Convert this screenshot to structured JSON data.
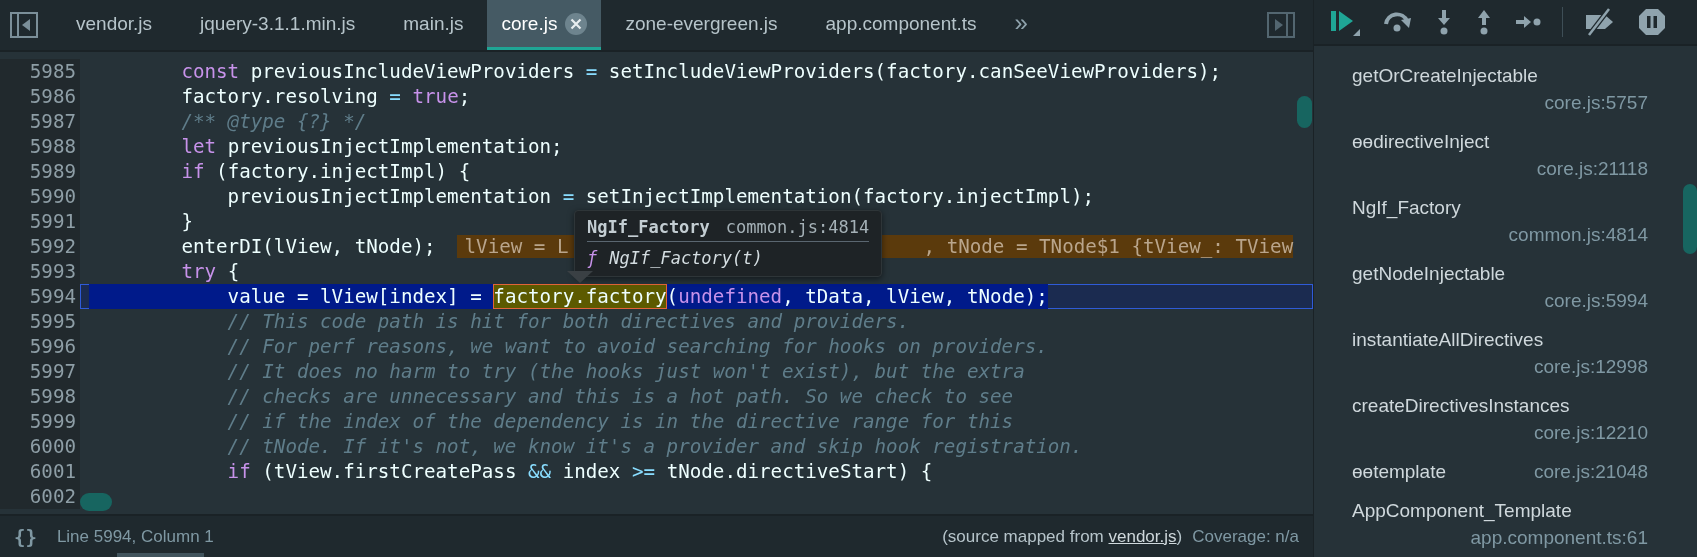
{
  "tabs": [
    {
      "label": "vendor.js",
      "selected": false
    },
    {
      "label": "jquery-3.1.1.min.js",
      "selected": false
    },
    {
      "label": "main.js",
      "selected": false
    },
    {
      "label": "core.js",
      "selected": true
    },
    {
      "label": "zone-evergreen.js",
      "selected": false
    },
    {
      "label": "app.component.ts",
      "selected": false
    }
  ],
  "overflow_label": "»",
  "editor": {
    "lines": [
      {
        "number": "5985",
        "current": false,
        "tokens": [
          {
            "text": "        const",
            "kind": "keyword"
          },
          {
            "text": " previousIncludeViewProviders ",
            "kind": "plain"
          },
          {
            "text": "=",
            "kind": "operator"
          },
          {
            "text": " setIncludeViewProviders(factory.canSeeViewProviders);",
            "kind": "plain"
          }
        ]
      },
      {
        "number": "5986",
        "current": false,
        "tokens": [
          {
            "text": "        factory.resolving ",
            "kind": "plain"
          },
          {
            "text": "=",
            "kind": "operator"
          },
          {
            "text": " true",
            "kind": "keyword"
          },
          {
            "text": ";",
            "kind": "plain"
          }
        ]
      },
      {
        "number": "5987",
        "current": false,
        "tokens": [
          {
            "text": "        /** @type {?} */",
            "kind": "comment"
          }
        ]
      },
      {
        "number": "5988",
        "current": false,
        "tokens": [
          {
            "text": "        let",
            "kind": "keyword"
          },
          {
            "text": " previousInjectImplementation;",
            "kind": "plain"
          }
        ]
      },
      {
        "number": "5989",
        "current": false,
        "tokens": [
          {
            "text": "        if",
            "kind": "keyword"
          },
          {
            "text": " (factory.injectImpl) {",
            "kind": "plain"
          }
        ]
      },
      {
        "number": "5990",
        "current": false,
        "tokens": [
          {
            "text": "            previousInjectImplementation ",
            "kind": "plain"
          },
          {
            "text": "=",
            "kind": "operator"
          },
          {
            "text": " setInjectImplementation(factory.injectImpl);",
            "kind": "plain"
          }
        ]
      },
      {
        "number": "5991",
        "current": false,
        "tokens": [
          {
            "text": "        }",
            "kind": "plain"
          }
        ]
      },
      {
        "number": "5992",
        "current": false,
        "tokens": [
          {
            "text": "        enterDI(lView, tNode);",
            "kind": "plain"
          }
        ],
        "inline_value": [
          "lView = L",
          ", tNode = TNode$1 {tView_: TView"
        ]
      },
      {
        "number": "5993",
        "current": false,
        "tokens": [
          {
            "text": "        try",
            "kind": "keyword"
          },
          {
            "text": " {",
            "kind": "plain"
          }
        ]
      },
      {
        "number": "5994",
        "current": true,
        "tokens": [
          {
            "text": "            value = lView[index] = ",
            "kind": "plain"
          },
          {
            "text": "factory.factory",
            "kind": "match"
          },
          {
            "text": "(",
            "kind": "plain"
          },
          {
            "text": "undefined",
            "kind": "keyword"
          },
          {
            "text": ", tData, lView, tNode);",
            "kind": "plain"
          }
        ]
      },
      {
        "number": "5995",
        "current": false,
        "tokens": [
          {
            "text": "            // This code path is hit for both directives and providers.",
            "kind": "comment"
          }
        ]
      },
      {
        "number": "5996",
        "current": false,
        "tokens": [
          {
            "text": "            // For perf reasons, we want to avoid searching for hooks on providers.",
            "kind": "comment"
          }
        ]
      },
      {
        "number": "5997",
        "current": false,
        "tokens": [
          {
            "text": "            // It does no harm to try (the hooks just won't exist), but the extra",
            "kind": "comment"
          }
        ]
      },
      {
        "number": "5998",
        "current": false,
        "tokens": [
          {
            "text": "            // checks are unnecessary and this is a hot path. So we check to see",
            "kind": "comment"
          }
        ]
      },
      {
        "number": "5999",
        "current": false,
        "tokens": [
          {
            "text": "            // if the index of the dependency is in the directive range for this",
            "kind": "comment"
          }
        ]
      },
      {
        "number": "6000",
        "current": false,
        "tokens": [
          {
            "text": "            // tNode. If it's not, we know it's a provider and skip hook registration.",
            "kind": "comment"
          }
        ]
      },
      {
        "number": "6001",
        "current": false,
        "tokens": [
          {
            "text": "            if",
            "kind": "keyword"
          },
          {
            "text": " (tView.firstCreatePass ",
            "kind": "plain"
          },
          {
            "text": "&&",
            "kind": "operator"
          },
          {
            "text": " index ",
            "kind": "plain"
          },
          {
            "text": ">=",
            "kind": "operator"
          },
          {
            "text": " tNode.directiveStart) {",
            "kind": "plain"
          }
        ]
      },
      {
        "number": "6002",
        "current": false
      }
    ],
    "tooltip": {
      "title": "NgIf_Factory",
      "location": "common.js:4814",
      "symbol": "ƒ",
      "signature": "NgIf_Factory(t)"
    }
  },
  "status_bar": {
    "icon_label": "{}",
    "position": "Line 5994, Column 1",
    "source_prefix": "(source mapped from ",
    "source_link": "vendor.js",
    "source_suffix": ")",
    "coverage": "Coverage: n/a"
  },
  "call_stack": [
    {
      "function": "getOrCreateInjectable",
      "location": "core.js:5757",
      "kind": "stacked"
    },
    {
      "function": "ɵɵdirectiveInject",
      "location": "core.js:21118",
      "kind": "stacked"
    },
    {
      "function": "NgIf_Factory",
      "location": "common.js:4814",
      "kind": "stacked"
    },
    {
      "function": "getNodeInjectable",
      "location": "core.js:5994",
      "kind": "stacked"
    },
    {
      "function": "instantiateAllDirectives",
      "location": "core.js:12998",
      "kind": "stacked"
    },
    {
      "function": "createDirectivesInstances",
      "location": "core.js:12210",
      "kind": "stacked"
    },
    {
      "function": "ɵɵtemplate",
      "location": "core.js:21048",
      "kind": "inline"
    },
    {
      "function": "AppComponent_Template",
      "location": "app.component.ts:61",
      "kind": "stacked"
    }
  ]
}
